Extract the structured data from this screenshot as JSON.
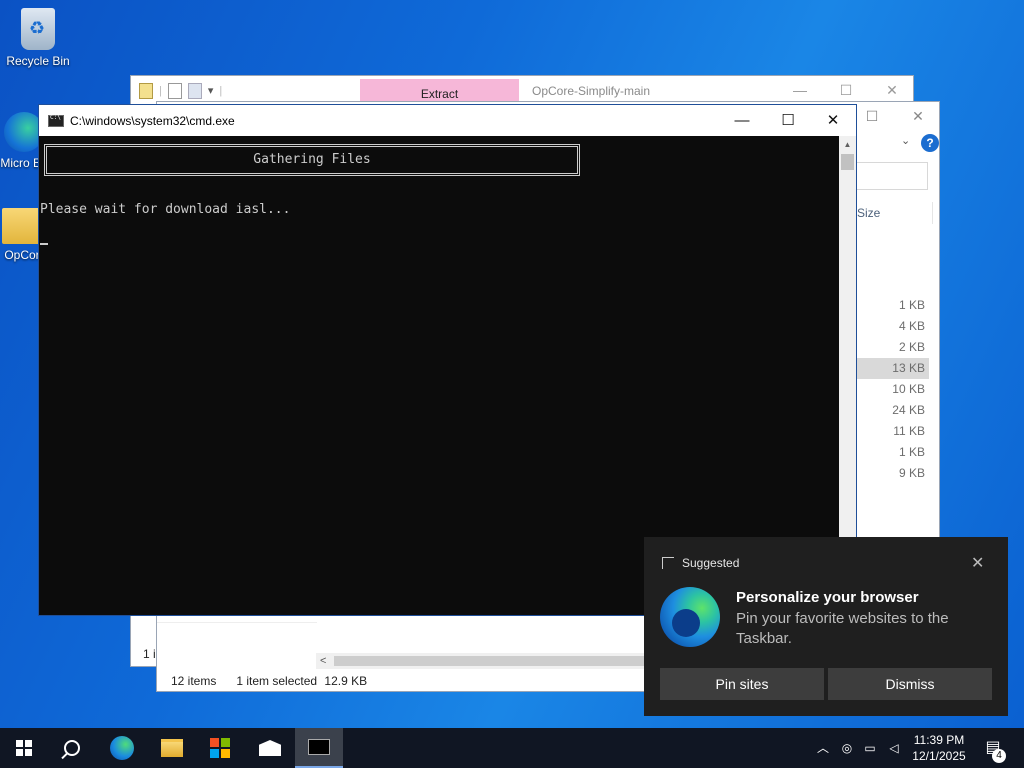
{
  "desktop": {
    "icons": [
      {
        "label": "Recycle Bin"
      },
      {
        "label": "Micro Ed"
      },
      {
        "label": "OpCor"
      }
    ]
  },
  "explorer_back": {
    "ribbon_tab": "Extract",
    "title": "OpCore-Simplify-main",
    "status_partial": "1 i"
  },
  "explorer_front": {
    "column_header": "Size",
    "sizes": [
      "1 KB",
      "4 KB",
      "2 KB",
      "13 KB",
      "10 KB",
      "24 KB",
      "11 KB",
      "1 KB",
      "9 KB"
    ],
    "selected_index": 3,
    "status": {
      "items": "12 items",
      "selected": "1 item selected",
      "size": "12.9 KB"
    }
  },
  "cmd": {
    "title": "C:\\windows\\system32\\cmd.exe",
    "banner": "Gathering Files",
    "line": "Please wait for download iasl..."
  },
  "toast": {
    "header": "Suggested",
    "title": "Personalize your browser",
    "body": "Pin your favorite websites to the Taskbar.",
    "primary_button": "Pin sites",
    "secondary_button": "Dismiss"
  },
  "taskbar": {
    "time": "11:39 PM",
    "date": "12/1/2025",
    "notification_count": "4"
  },
  "icons": {
    "minimize": "—",
    "maximize": "☐",
    "close": "✕",
    "help": "?",
    "chevron": "⌄",
    "caret_up": "︿",
    "scroll_left": "<",
    "scroll_up": "▲"
  }
}
